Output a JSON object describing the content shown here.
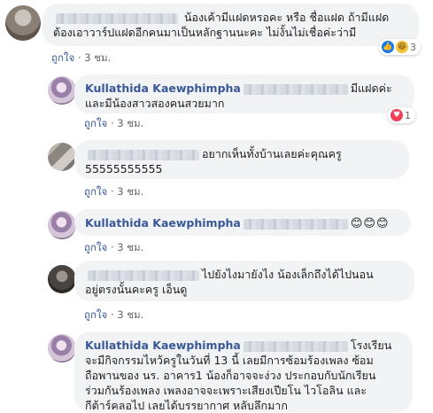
{
  "comments": [
    {
      "text": "น้องเค้ามีแฝดหรอคะ หรือ ชื่อแฝด ถ้ามีแฝดต้องเอาวาร์ปแฝดอีกคนมาเป็นหลักฐานนะคะ ไม่งั้นไม่เชื่อค่ะว่ามี",
      "line1": "น้องเค้ามีแฝดหรอคะ หรือ ชื่อแฝด ถ้ามีแฝด",
      "line2": "ต้องเอาวาร์ปแฝดอีกคนมาเป็นหลักฐานนะคะ ไม่งั้นไม่เชื่อค่ะว่ามี",
      "like": "ถูกใจ",
      "time": "3 ชม.",
      "reactions": {
        "icons": [
          "like-icon",
          "haha-icon"
        ],
        "count": "3"
      }
    },
    {
      "author": "Kullathida Kaewphimpha",
      "line1": "มีแฝดค่ะ",
      "line2": "และมีน้องสาวสองคนสวยมาก",
      "like": "ถูกใจ",
      "time": "3 ชม.",
      "reactions": {
        "icons": [
          "love-icon"
        ],
        "count": "1"
      }
    },
    {
      "line1": "อยากเห็นทั้งบ้านเลยค่ะคุณครู",
      "line2": "55555555555",
      "like": "ถูกใจ",
      "time": "3 ชม."
    },
    {
      "author": "Kullathida Kaewphimpha",
      "emojis": "😊😊😊",
      "like": "ถูกใจ",
      "time": "3 ชม."
    },
    {
      "line1": "ไปยังไงมายังไง น้องเล็กถึงได้ไปนอน",
      "line2": "อยู่ตรงนั้นคะครู เอ็นดู",
      "like": "ถูกใจ",
      "time": "3 ชม."
    },
    {
      "author": "Kullathida Kaewphimpha",
      "line1": "โรงเรียน",
      "line2": "จะมีกิจกรรมไหว้ครูในวันที่ 13 นี้ เลยมีการซ้อมร้องเพลง ซ้อม",
      "line3": "ถือพานของ นร. อาคาร1 น้องก็อาจจะง่วง ประกอบกับนักเรียน",
      "line4": "ร่วมกันร้องเพลง เพลงอาจจะเพราะเสียงเปียโน ไวโอลิน และ",
      "line5": "กีต้าร์คลอไป เลยได้บรรยากาศ หลับลึกมาก"
    }
  ],
  "separator": "·",
  "colors": {
    "name": "#385898",
    "bubble": "#f2f3f5",
    "meta": "#606770",
    "like": "#1877f2",
    "love": "#f33e58"
  }
}
